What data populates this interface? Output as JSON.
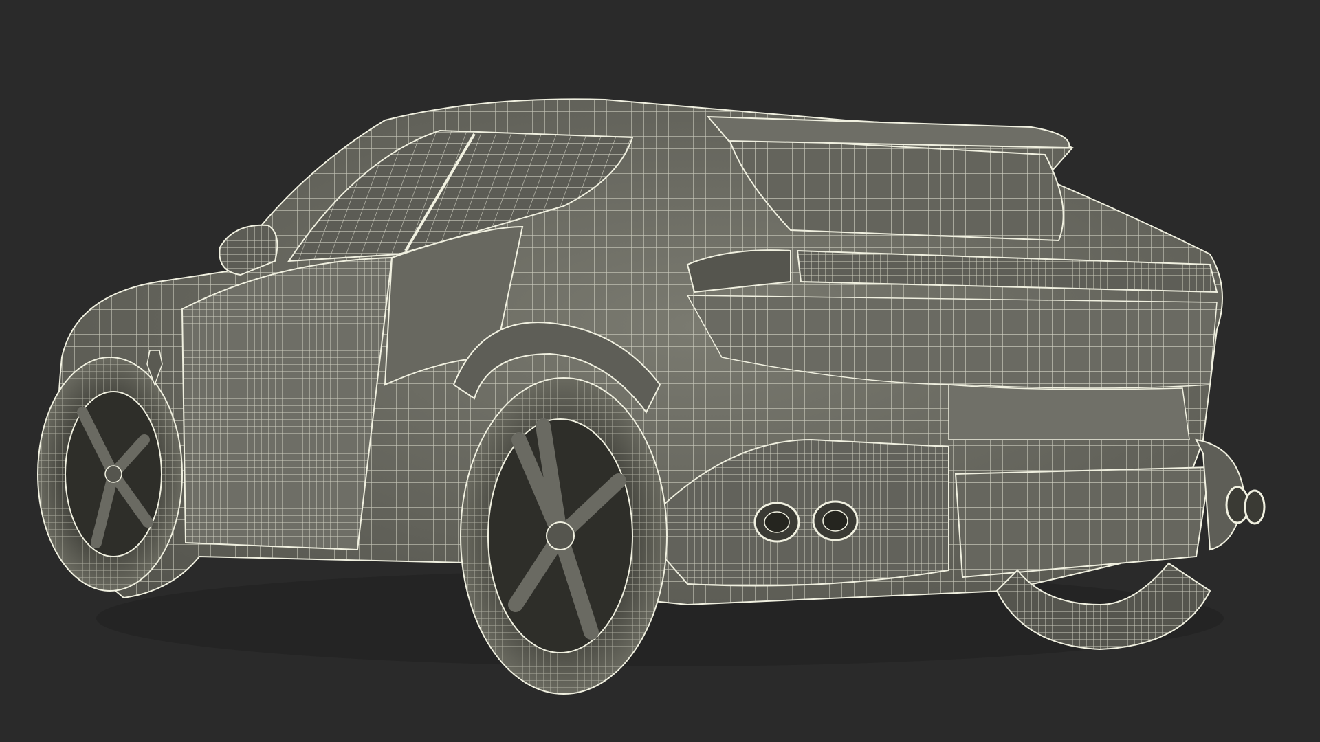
{
  "scene": {
    "subject": "wireframe-car-render",
    "background_color": "#2a2a2a",
    "surface_color": "#6b6b63",
    "surface_shadow_color": "#4a4a45",
    "wire_color": "#e8e8d8",
    "tire_color": "#505048"
  }
}
